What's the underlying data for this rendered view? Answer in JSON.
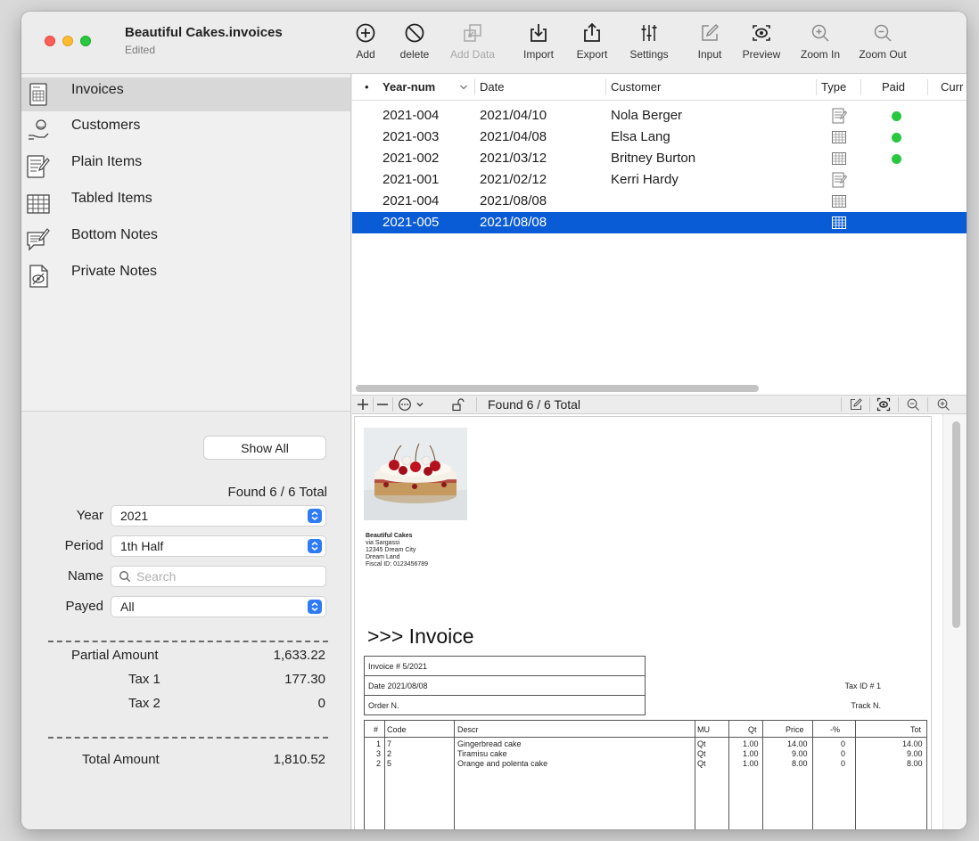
{
  "window": {
    "title": "Beautiful Cakes.invoices",
    "subtitle": "Edited"
  },
  "toolbar": {
    "items": [
      {
        "label": "Add",
        "icon": "add-circle-icon",
        "enabled": true
      },
      {
        "label": "delete",
        "icon": "prohibit-icon",
        "enabled": true
      },
      {
        "label": "Add Data",
        "icon": "add-data-icon",
        "enabled": false
      },
      {
        "label": "Import",
        "icon": "import-tray-icon",
        "enabled": true
      },
      {
        "label": "Export",
        "icon": "export-share-icon",
        "enabled": true
      },
      {
        "label": "Settings",
        "icon": "sliders-icon",
        "enabled": true
      },
      {
        "label": "Input",
        "icon": "pencil-square-icon",
        "enabled": true
      },
      {
        "label": "Preview",
        "icon": "eye-preview-icon",
        "enabled": true
      },
      {
        "label": "Zoom In",
        "icon": "zoom-in-icon",
        "enabled": true
      },
      {
        "label": "Zoom Out",
        "icon": "zoom-out-icon",
        "enabled": true
      }
    ]
  },
  "sidebar": {
    "items": [
      {
        "label": "Invoices",
        "icon": "invoice-sheet-icon",
        "selected": true
      },
      {
        "label": "Customers",
        "icon": "customer-hand-icon",
        "selected": false
      },
      {
        "label": "Plain Items",
        "icon": "plain-items-icon",
        "selected": false
      },
      {
        "label": "Tabled Items",
        "icon": "table-grid-icon",
        "selected": false
      },
      {
        "label": "Bottom Notes",
        "icon": "note-pencil-icon",
        "selected": false
      },
      {
        "label": "Private Notes",
        "icon": "private-eye-icon",
        "selected": false
      }
    ]
  },
  "filter": {
    "show_all_label": "Show All",
    "found_text": "Found 6 / 6 Total",
    "year_label": "Year",
    "year_value": "2021",
    "period_label": "Period",
    "period_value": "1th Half",
    "name_label": "Name",
    "name_placeholder": "Search",
    "payed_label": "Payed",
    "payed_value": "All"
  },
  "summary": {
    "partial_label": "Partial Amount",
    "partial_value": "1,633.22",
    "tax1_label": "Tax 1",
    "tax1_value": "177.30",
    "tax2_label": "Tax 2",
    "tax2_value": "0",
    "total_label": "Total Amount",
    "total_value": "1,810.52"
  },
  "table": {
    "columns": {
      "dot": "•",
      "year_num": "Year-num",
      "date": "Date",
      "customer": "Customer",
      "type": "Type",
      "paid": "Paid",
      "currency": "Curr"
    },
    "rows": [
      {
        "year_num": "2021-004",
        "date": "2021/04/10",
        "customer": "Nola Berger",
        "type": "plain",
        "paid": true,
        "selected": false
      },
      {
        "year_num": "2021-003",
        "date": "2021/04/08",
        "customer": "Elsa Lang",
        "type": "tabled",
        "paid": true,
        "selected": false
      },
      {
        "year_num": "2021-002",
        "date": "2021/03/12",
        "customer": "Britney Burton",
        "type": "tabled",
        "paid": true,
        "selected": false
      },
      {
        "year_num": "2021-001",
        "date": "2021/02/12",
        "customer": "Kerri Hardy",
        "type": "plain",
        "paid": false,
        "selected": false
      },
      {
        "year_num": "2021-004",
        "date": "2021/08/08",
        "customer": "",
        "type": "tabled",
        "paid": false,
        "selected": false
      },
      {
        "year_num": "2021-005",
        "date": "2021/08/08",
        "customer": "",
        "type": "tabled",
        "paid": false,
        "selected": true
      }
    ]
  },
  "midbar": {
    "found_text": "Found 6 / 6 Total"
  },
  "preview": {
    "company_lines": [
      "Beautiful Cakes",
      "via Sargassi",
      "12345 Dream City",
      "Dream Land",
      "Fiscal ID: 0123456789"
    ],
    "heading": ">>> Invoice",
    "invoice_number": "Invoice # 5/2021",
    "date_line": "Date 2021/08/08",
    "order_line": "Order N.",
    "tax_id_label": "Tax ID # 1",
    "track_label": "Track N.",
    "item_headers": {
      "num": "#",
      "code": "Code",
      "descr": "Descr",
      "mu": "MU",
      "qt": "Qt",
      "price": "Price",
      "disc": "-%",
      "tot": "Tot"
    },
    "items": [
      {
        "num": "1",
        "code": "7",
        "descr": "Gingerbread cake",
        "mu": "Qt",
        "qt": "1.00",
        "price": "14.00",
        "disc": "0",
        "tot": "14.00"
      },
      {
        "num": "3",
        "code": "2",
        "descr": "Tiramisu cake",
        "mu": "Qt",
        "qt": "1.00",
        "price": "9.00",
        "disc": "0",
        "tot": "9.00"
      },
      {
        "num": "2",
        "code": "5",
        "descr": "Orange and polenta cake",
        "mu": "Qt",
        "qt": "1.00",
        "price": "8.00",
        "disc": "0",
        "tot": "8.00"
      }
    ]
  },
  "colors": {
    "selection": "#0a5bd6",
    "paid_dot": "#28c840",
    "accent": "#2f7bf5"
  }
}
